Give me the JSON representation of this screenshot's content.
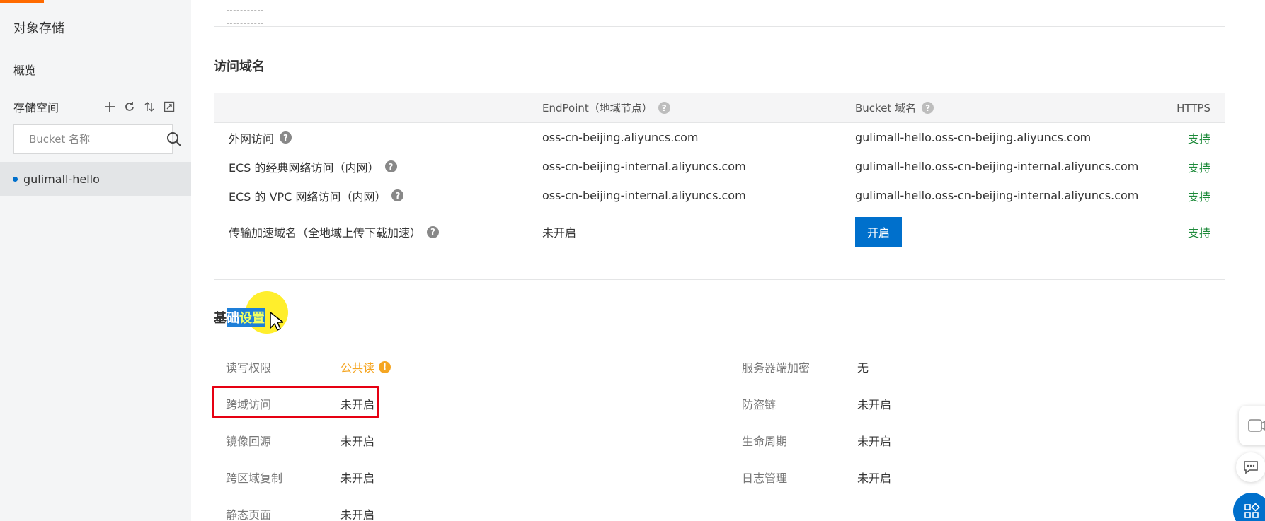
{
  "sidebar": {
    "title": "对象存储",
    "overview": "概览",
    "buckets_label": "存储空间",
    "search_placeholder": "Bucket 名称",
    "buckets": [
      {
        "name": "gulimall-hello"
      }
    ],
    "tools": [
      "plus-icon",
      "refresh-icon",
      "sort-icon",
      "expand-icon"
    ]
  },
  "endpoints": {
    "title": "访问域名",
    "headers": {
      "endpoint": "EndPoint（地域节点）",
      "bucket_domain": "Bucket 域名",
      "https": "HTTPS"
    },
    "rows": [
      {
        "type": "外网访问",
        "endpoint": "oss-cn-beijing.aliyuncs.com",
        "domain": "gulimall-hello.oss-cn-beijing.aliyuncs.com",
        "https": "支持"
      },
      {
        "type": "ECS 的经典网络访问（内网）",
        "endpoint": "oss-cn-beijing-internal.aliyuncs.com",
        "domain": "gulimall-hello.oss-cn-beijing-internal.aliyuncs.com",
        "https": "支持"
      },
      {
        "type": "ECS 的 VPC 网络访问（内网）",
        "endpoint": "oss-cn-beijing-internal.aliyuncs.com",
        "domain": "gulimall-hello.oss-cn-beijing-internal.aliyuncs.com",
        "https": "支持"
      },
      {
        "type": "传输加速域名（全地域上传下载加速）",
        "endpoint": "未开启",
        "button": "开启",
        "https": "支持"
      }
    ]
  },
  "basic_settings": {
    "title_prefix": "基",
    "title_highlight_1": "础",
    "title_highlight_2": "设置",
    "left": [
      {
        "label": "读写权限",
        "value": "公共读"
      },
      {
        "label": "跨域访问",
        "value": "未开启"
      },
      {
        "label": "镜像回源",
        "value": "未开启"
      },
      {
        "label": "跨区域复制",
        "value": "未开启"
      },
      {
        "label": "静态页面",
        "value": "未开启"
      }
    ],
    "right": [
      {
        "label": "服务器端加密",
        "value": "无"
      },
      {
        "label": "防盗链",
        "value": "未开启"
      },
      {
        "label": "生命周期",
        "value": "未开启"
      },
      {
        "label": "日志管理",
        "value": "未开启"
      }
    ]
  },
  "colors": {
    "accent": "#ff6a00",
    "primary": "#0070cc",
    "support": "#1d8a3a",
    "warning": "#f5a623",
    "highlight_box": "#e60012"
  }
}
